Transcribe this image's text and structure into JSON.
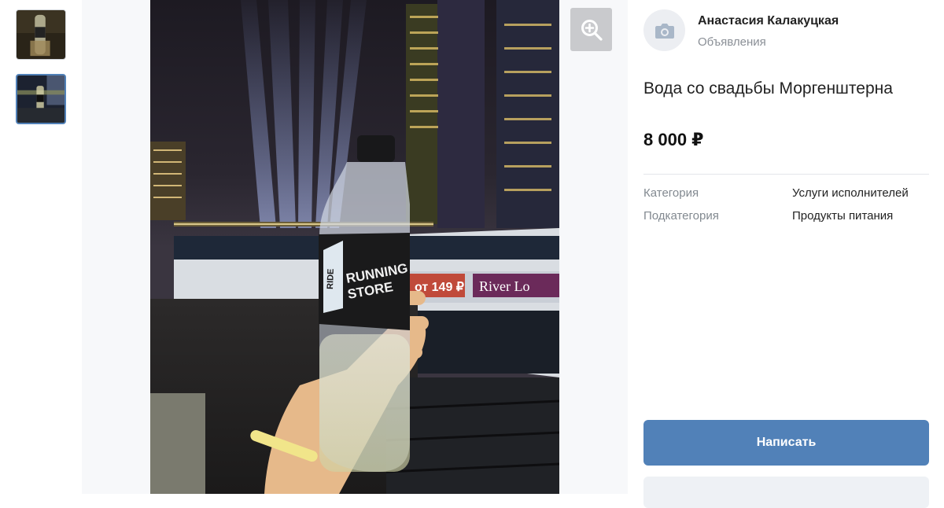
{
  "seller": {
    "name": "Анастасия Калакуцкая",
    "subtitle": "Объявления",
    "avatar_icon": "camera-icon"
  },
  "item": {
    "title": "Вода со свадьбы Моргенштерна",
    "price": "8 000 ₽"
  },
  "properties": [
    {
      "key": "Категория",
      "value": "Услуги исполнителей"
    },
    {
      "key": "Подкатегория",
      "value": "Продукты питания"
    }
  ],
  "photo": {
    "bottle_label_line1": "RUNNING",
    "bottle_label_line2": "STORE",
    "bottle_label_side": "RIDE",
    "boat_sign": "River Lo",
    "boat_price": "от 149 ₽"
  },
  "actions": {
    "write_label": "Написать"
  },
  "colors": {
    "accent": "#5181b8",
    "muted_text": "#828990"
  }
}
